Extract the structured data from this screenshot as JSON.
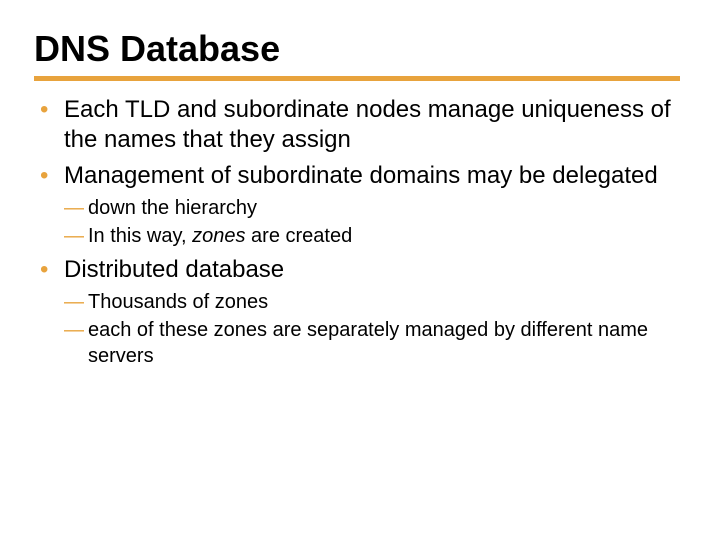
{
  "title": "DNS Database",
  "bullets": {
    "b1": "Each TLD and subordinate nodes manage uniqueness of the names that they assign",
    "b2": "Management of subordinate domains may be delegated",
    "b2s1": "down the hierarchy",
    "b2s2a": "In this way, ",
    "b2s2b": "zones",
    "b2s2c": " are created",
    "b3": "Distributed database",
    "b3s1": "Thousands of zones",
    "b3s2": "each of these zones are separately managed by different name servers"
  }
}
